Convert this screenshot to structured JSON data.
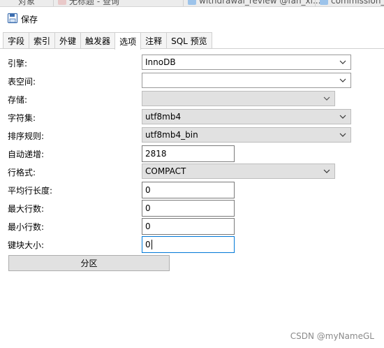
{
  "doc_tabs": [
    {
      "label": "对象"
    },
    {
      "label": "无标题 - 查询"
    },
    {
      "label": "withdrawal_review @fan_xi..."
    },
    {
      "label": "commission_"
    }
  ],
  "toolbar": {
    "save_label": "保存"
  },
  "prop_tabs": [
    {
      "label": "字段"
    },
    {
      "label": "索引"
    },
    {
      "label": "外键"
    },
    {
      "label": "触发器"
    },
    {
      "label": "选项"
    },
    {
      "label": "注释"
    },
    {
      "label": "SQL 预览"
    }
  ],
  "active_tab": "选项",
  "options": {
    "engine": {
      "label": "引擎:",
      "value": "InnoDB"
    },
    "tablespace": {
      "label": "表空间:",
      "value": ""
    },
    "storage": {
      "label": "存储:",
      "value": ""
    },
    "charset": {
      "label": "字符集:",
      "value": "utf8mb4"
    },
    "collation": {
      "label": "排序规则:",
      "value": "utf8mb4_bin"
    },
    "auto_increment": {
      "label": "自动递增:",
      "value": "2818"
    },
    "row_format": {
      "label": "行格式:",
      "value": "COMPACT"
    },
    "avg_row_length": {
      "label": "平均行长度:",
      "value": "0"
    },
    "max_rows": {
      "label": "最大行数:",
      "value": "0"
    },
    "min_rows": {
      "label": "最小行数:",
      "value": "0"
    },
    "key_block_size": {
      "label": "键块大小:",
      "value": "0"
    }
  },
  "partition_button": "分区",
  "watermark": "CSDN @myNameGL",
  "colors": {
    "focus_border": "#0078d7",
    "disabled_bg": "#e1e1e1",
    "accent_blue": "#2f7fd6"
  }
}
